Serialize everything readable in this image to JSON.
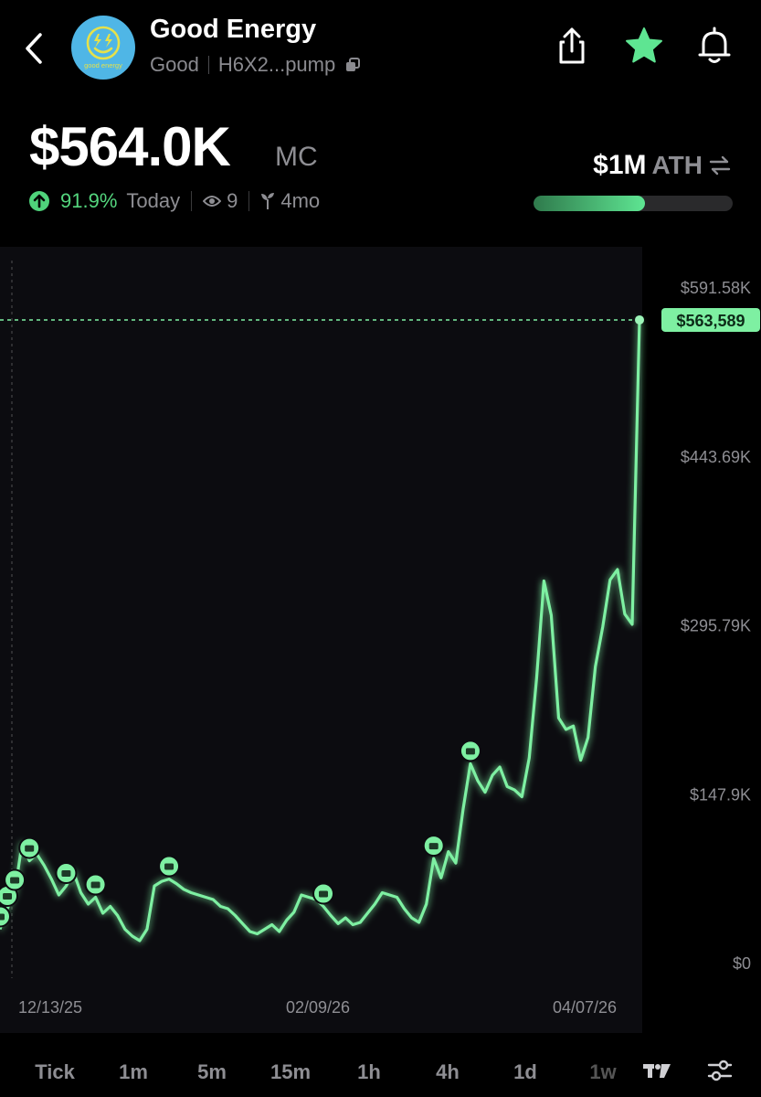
{
  "header": {
    "token_name": "Good Energy",
    "symbol": "Good",
    "address": "H6X2...pump",
    "logo_text": "good energy",
    "icons": [
      "back-chevron-icon",
      "share-icon",
      "star-icon",
      "bell-icon",
      "copy-icon"
    ],
    "star_color": "#5ee592"
  },
  "market": {
    "value": "$564.0K",
    "suffix": "MC",
    "change_pct": "91.9%",
    "change_period": "Today",
    "watchers": "9",
    "age": "4mo",
    "ath_value": "$1M",
    "ath_label": "ATH",
    "ath_progress": 0.56
  },
  "chart_data": {
    "type": "line",
    "y_ticks": [
      "$591.58K",
      "$443.69K",
      "$295.79K",
      "$147.9K",
      "$0"
    ],
    "x_ticks": [
      "12/13/25",
      "02/09/26",
      "04/07/26"
    ],
    "current_price_label": "$563,589",
    "ylim": [
      0,
      591580
    ],
    "line_color": "#7ef0a2",
    "series": [
      {
        "values": [
          30000,
          48000,
          62000,
          105000,
          90000,
          96000,
          86000,
          74000,
          60000,
          68000,
          80000,
          62000,
          52000,
          58000,
          44000,
          50000,
          42000,
          30000,
          24000,
          20000,
          30000,
          68000,
          72000,
          74000,
          70000,
          65000,
          62000,
          60000,
          58000,
          56000,
          50000,
          48000,
          42000,
          35000,
          28000,
          26000,
          30000,
          34000,
          28000,
          38000,
          45000,
          60000,
          58000,
          56000,
          50000,
          42000,
          35000,
          40000,
          34000,
          36000,
          44000,
          52000,
          62000,
          60000,
          58000,
          48000,
          40000,
          36000,
          52000,
          92000,
          75000,
          98000,
          88000,
          135000,
          175000,
          160000,
          150000,
          165000,
          172000,
          155000,
          152000,
          146000,
          180000,
          250000,
          335000,
          305000,
          215000,
          205000,
          208000,
          178000,
          198000,
          260000,
          295000,
          336000,
          345000,
          306000,
          297000,
          563589
        ]
      }
    ],
    "trade_markers": 10
  },
  "timeframes": {
    "items": [
      "Tick",
      "1m",
      "5m",
      "15m",
      "1h",
      "4h",
      "1d",
      "1w"
    ],
    "active": "1w",
    "icons": [
      "tradingview-icon",
      "settings-sliders-icon"
    ]
  }
}
